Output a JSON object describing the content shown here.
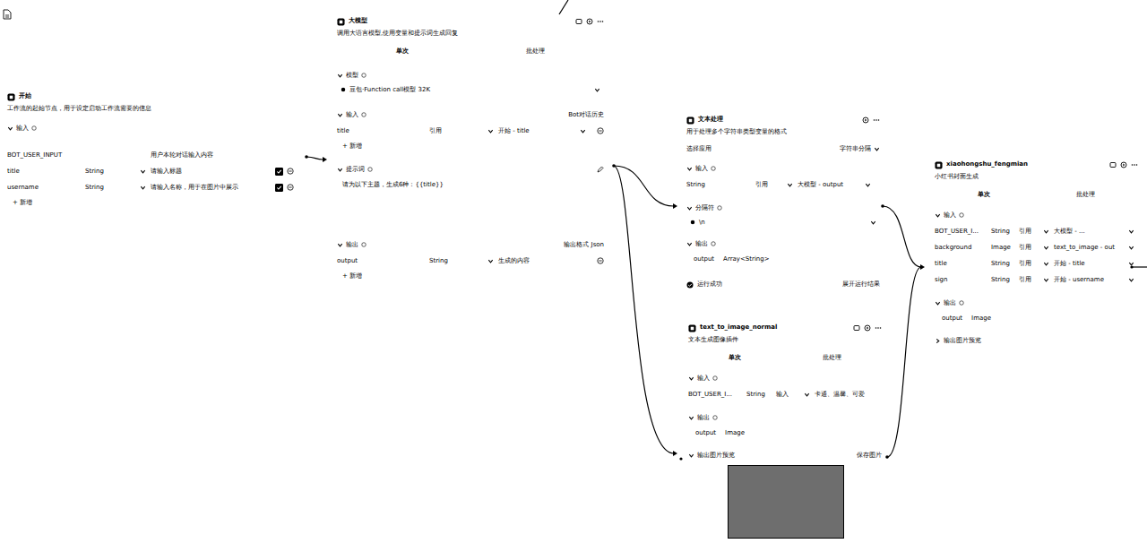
{
  "nodes": [
    {
      "title": "开始",
      "description": "工作流的起始节点，用于设定启动工作流需要的信息",
      "sections": [
        {
          "kind": "fields",
          "label": "输入",
          "rows": [
            {
              "kind": "system",
              "cells": [
                {
                  "text": "BOT_USER_INPUT"
                },
                {
                  "text": "用户本轮对话输入内容"
                }
              ]
            },
            {
              "kind": "param",
              "required": true,
              "cells": [
                {
                  "text": "title"
                },
                {
                  "text": "String",
                  "select": true
                },
                {
                  "text": "请输入标题"
                }
              ]
            },
            {
              "kind": "param",
              "required": true,
              "cells": [
                {
                  "text": "username"
                },
                {
                  "text": "String",
                  "select": true
                },
                {
                  "text": "请输入名称，用于在图片中展示"
                }
              ]
            }
          ],
          "add": "+ 新增"
        }
      ]
    },
    {
      "title": "大模型",
      "description": "调用大语言模型,使用变量和提示词生成回复",
      "tabs": [
        {
          "label": "单次",
          "selected": true
        },
        {
          "label": "批处理",
          "selected": false
        }
      ],
      "sections": [
        {
          "kind": "box",
          "label": "模型",
          "text": "豆包·Function call模型 32K"
        },
        {
          "kind": "fields",
          "label": "输入",
          "extra": "Bot对话历史",
          "rows": [
            {
              "kind": "ref",
              "cells": [
                {
                  "text": "title"
                },
                {
                  "text": "引用",
                  "select": true
                },
                {
                  "text": "开始 - title",
                  "select": true
                }
              ]
            }
          ],
          "add": "+ 新增"
        },
        {
          "kind": "text",
          "label": "提示词",
          "text": "请为以下主题，生成6种：{{title}}"
        },
        {
          "kind": "fields",
          "label": "输出",
          "extra": "输出格式  Json",
          "rows": [
            {
              "kind": "ref",
              "cells": [
                {
                  "text": "output"
                },
                {
                  "text": "String",
                  "select": true
                },
                {
                  "text": "生成的内容"
                }
              ]
            }
          ],
          "add": "+ 新增"
        }
      ]
    },
    {
      "title": "文本处理",
      "description": "用于处理多个字符串类型变量的格式",
      "sections": [
        {
          "kind": "option",
          "label": "选择应用",
          "text": "字符串分隔"
        },
        {
          "kind": "fields",
          "label": "输入",
          "rows": [
            {
              "kind": "bound",
              "cells": [
                {
                  "text": "String"
                },
                {
                  "text": "引用",
                  "select": true
                },
                {
                  "text": "大模型 - output",
                  "select": true
                }
              ]
            }
          ]
        },
        {
          "kind": "box",
          "label": "分隔符",
          "text": "\\n"
        },
        {
          "kind": "fields",
          "label": "输出",
          "rows": [
            {
              "kind": "tag",
              "cells": [
                {
                  "text": "output"
                },
                {
                  "text": "Array<String>"
                }
              ]
            }
          ]
        },
        {
          "kind": "status",
          "label": "运行成功",
          "extra": "展开运行结果"
        }
      ]
    },
    {
      "title": "text_to_image_normal",
      "description": "文本生成图像插件",
      "tabs": [
        {
          "label": "单次",
          "selected": true
        },
        {
          "label": "批处理",
          "selected": false
        }
      ],
      "sections": [
        {
          "kind": "fields",
          "label": "输入",
          "rows": [
            {
              "kind": "bound",
              "cells": [
                {
                  "text": "BOT_USER_I..."
                },
                {
                  "text": "String"
                },
                {
                  "text": "输入",
                  "select": true
                },
                {
                  "text": "卡通、温馨、可爱"
                }
              ]
            }
          ]
        },
        {
          "kind": "fields",
          "label": "输出",
          "rows": [
            {
              "kind": "tag",
              "cells": [
                {
                  "text": "output"
                },
                {
                  "text": "Image"
                }
              ]
            }
          ]
        },
        {
          "kind": "preview",
          "label": "输出图片预览",
          "extra": "保存图片"
        }
      ]
    },
    {
      "title": "xiaohongshu_fengmian",
      "description": "小红书封面生成",
      "tabs": [
        {
          "label": "单次",
          "selected": true
        },
        {
          "label": "批处理",
          "selected": false
        }
      ],
      "sections": [
        {
          "kind": "fields",
          "label": "输入",
          "rows": [
            {
              "kind": "bound",
              "cells": [
                {
                  "text": "BOT_USER_I..."
                },
                {
                  "text": "String"
                },
                {
                  "text": "引用",
                  "select": true
                },
                {
                  "text": "大模型 - ...",
                  "select": true
                }
              ]
            },
            {
              "kind": "bound",
              "cells": [
                {
                  "text": "background"
                },
                {
                  "text": "Image"
                },
                {
                  "text": "引用",
                  "select": true
                },
                {
                  "text": "text_to_image - out",
                  "select": true
                }
              ]
            },
            {
              "kind": "bound",
              "cells": [
                {
                  "text": "title"
                },
                {
                  "text": "String"
                },
                {
                  "text": "引用",
                  "select": true
                },
                {
                  "text": "开始 - title",
                  "select": true
                }
              ]
            },
            {
              "kind": "bound",
              "cells": [
                {
                  "text": "sign"
                },
                {
                  "text": "String"
                },
                {
                  "text": "引用",
                  "select": true
                },
                {
                  "text": "开始 - username",
                  "select": true
                }
              ]
            }
          ]
        },
        {
          "kind": "fields",
          "label": "输出",
          "rows": [
            {
              "kind": "tag",
              "cells": [
                {
                  "text": "output"
                },
                {
                  "text": "Image"
                }
              ]
            }
          ]
        },
        {
          "kind": "collapsed",
          "label": "输出图片预览"
        }
      ]
    }
  ]
}
